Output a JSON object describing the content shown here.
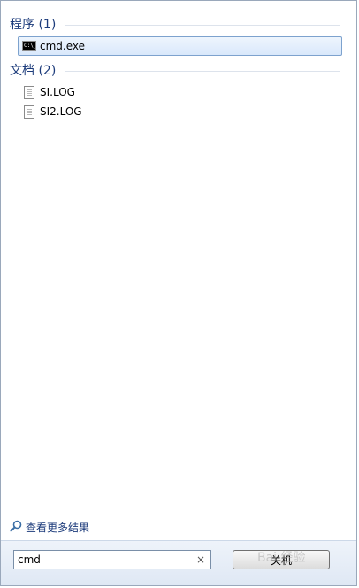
{
  "groups": [
    {
      "title": "程序 (1)",
      "items": [
        {
          "label": "cmd.exe",
          "icon": "console-icon",
          "icon_text": "C:\\_",
          "selected": true
        }
      ]
    },
    {
      "title": "文档 (2)",
      "items": [
        {
          "label": "SI.LOG",
          "icon": "document-icon"
        },
        {
          "label": "SI2.LOG",
          "icon": "document-icon"
        }
      ]
    }
  ],
  "see_more": {
    "label": "查看更多结果",
    "icon": "search-icon"
  },
  "search": {
    "value": "cmd",
    "clear_icon": "×"
  },
  "shutdown": {
    "label": "关机"
  },
  "watermark": {
    "text": "Bai 经验"
  },
  "colors": {
    "header_text": "#1c3b7b",
    "selection_border": "#7da2ce",
    "selection_fill": "#d9e8fb"
  }
}
